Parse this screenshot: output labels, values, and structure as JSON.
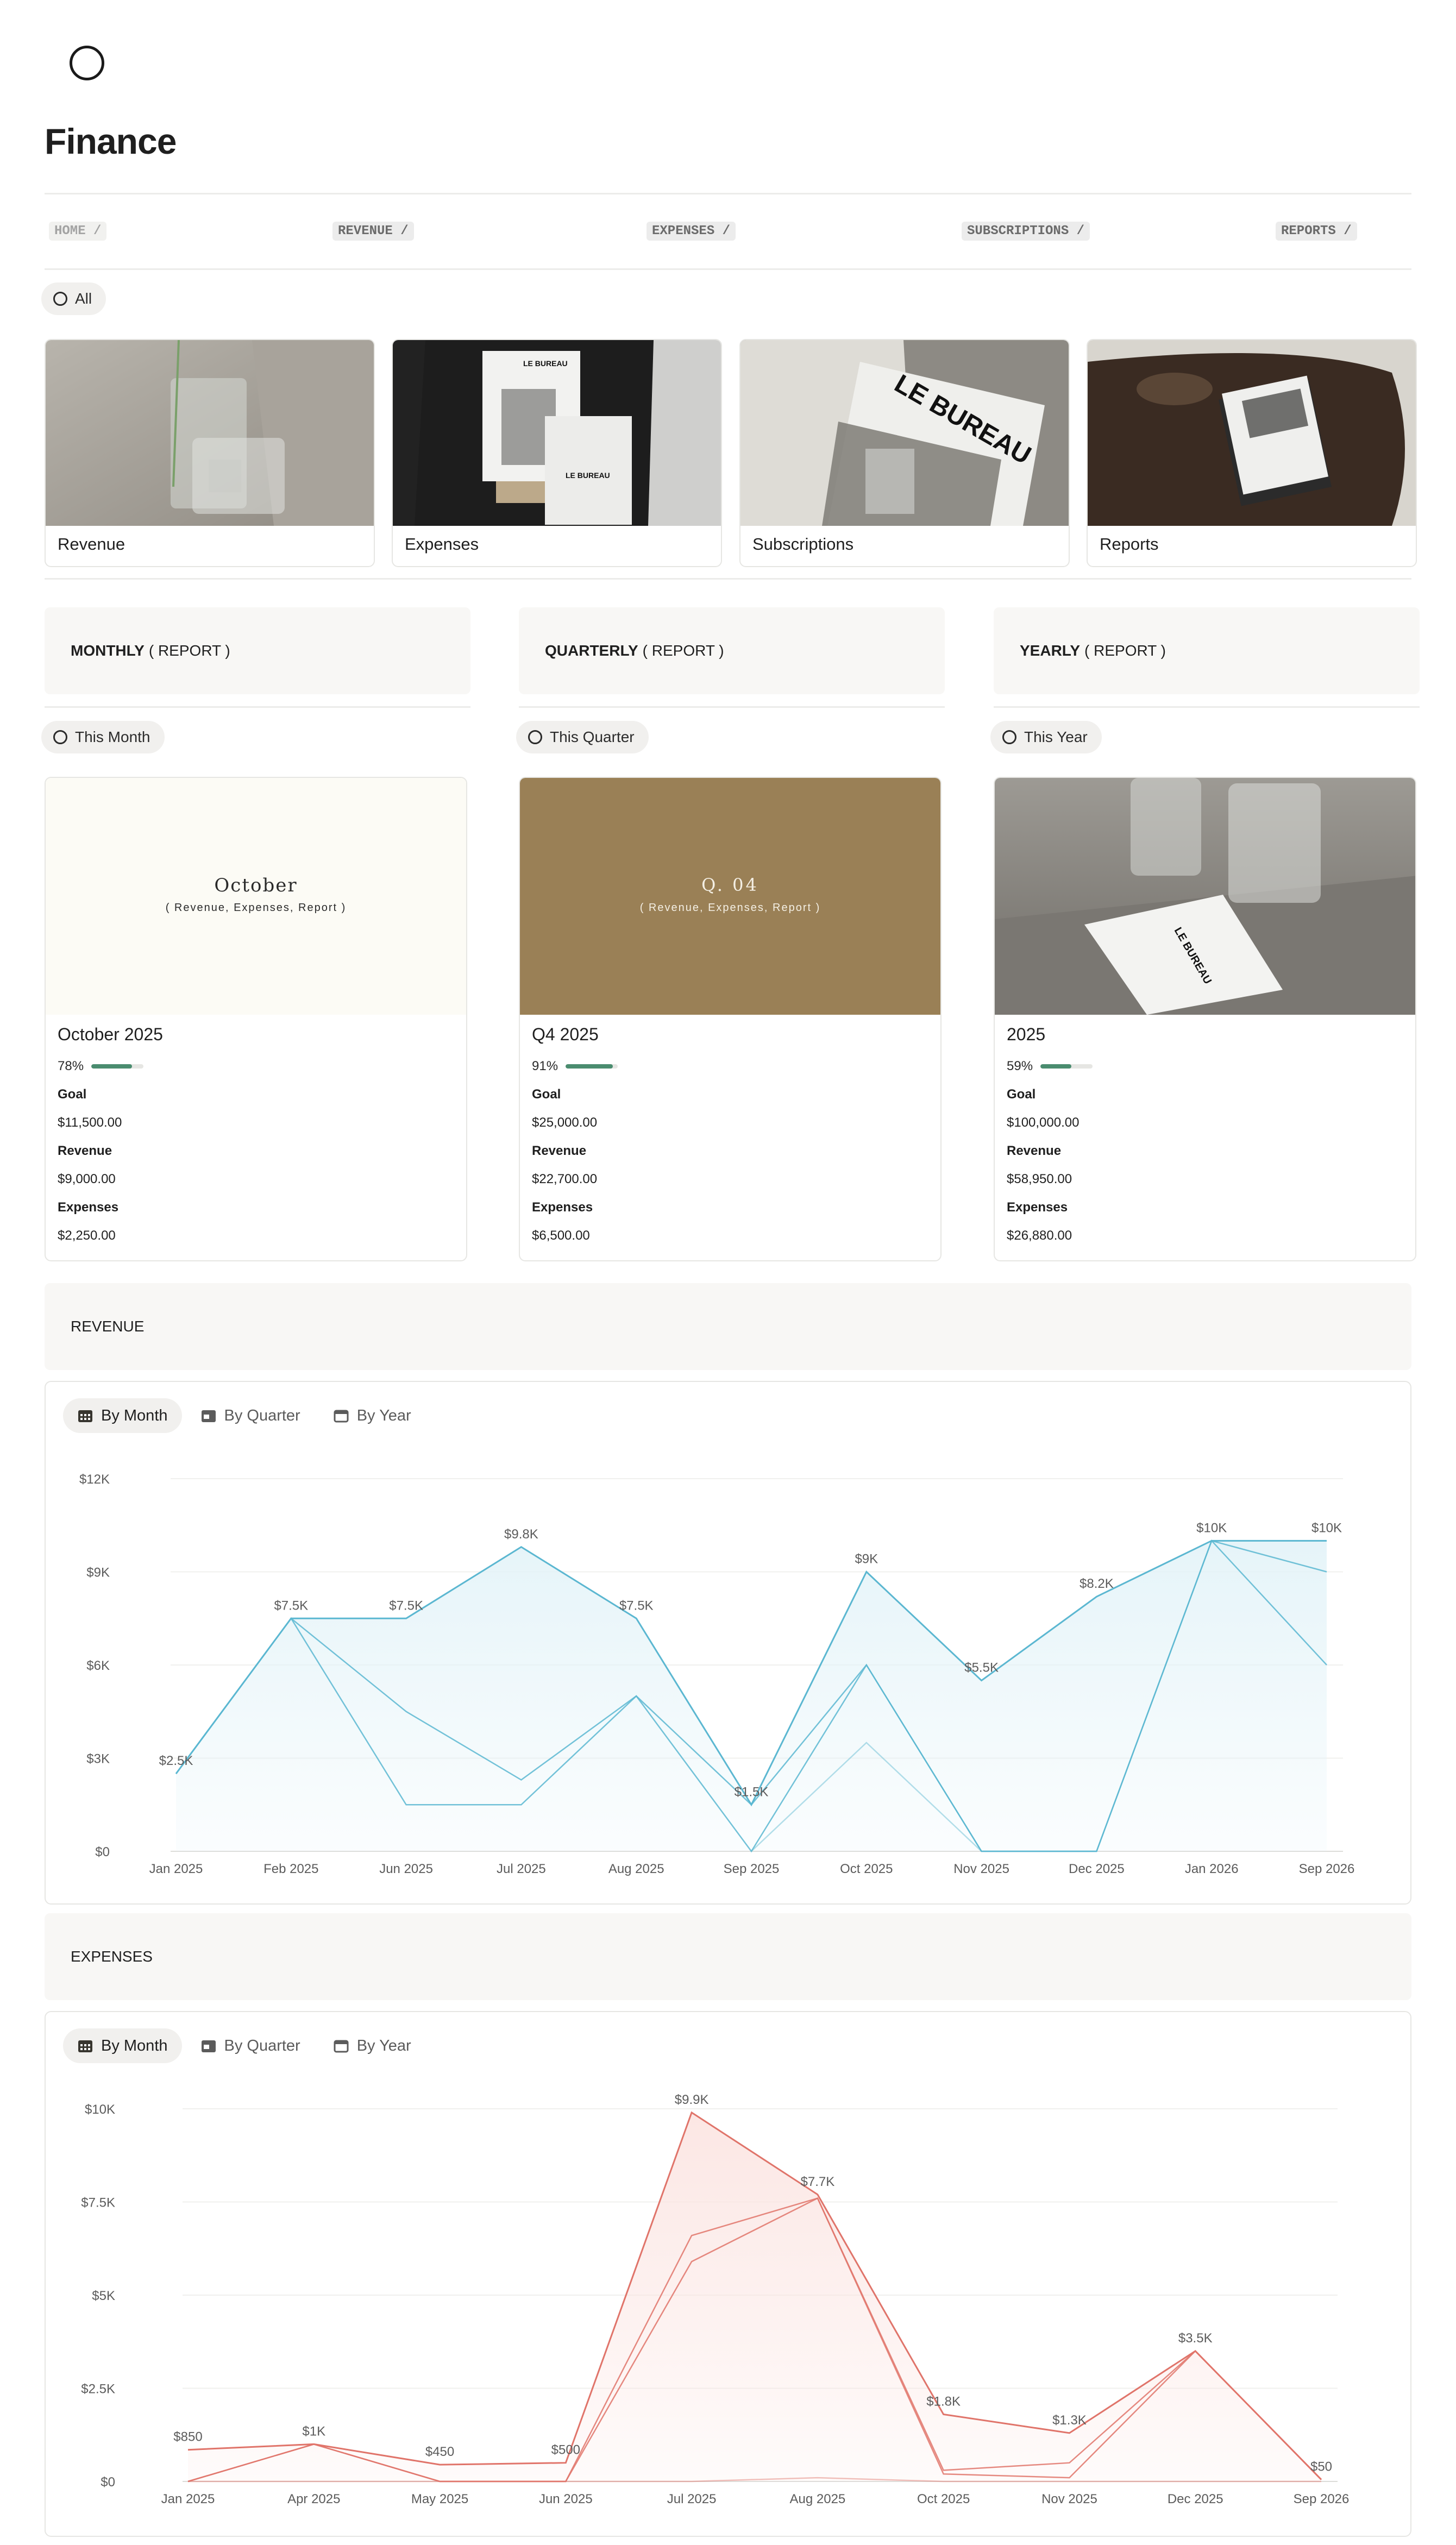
{
  "page": {
    "title": "Finance"
  },
  "nav": [
    {
      "label": "HOME /"
    },
    {
      "label": "REVENUE /"
    },
    {
      "label": "EXPENSES /"
    },
    {
      "label": "SUBSCRIPTIONS /"
    },
    {
      "label": "REPORTS /"
    }
  ],
  "gallery": {
    "filter_label": "All",
    "cards": [
      {
        "label": "Revenue"
      },
      {
        "label": "Expenses"
      },
      {
        "label": "Subscriptions"
      },
      {
        "label": "Reports"
      }
    ],
    "photo_text": {
      "brand": "LE BUREAU"
    }
  },
  "reports": [
    {
      "header_strong": "MONTHLY",
      "header_rest": "( REPORT )",
      "filter_label": "This Month",
      "cover_title": "October",
      "cover_subtitle": "( Revenue, Expenses, Report )",
      "title": "October 2025",
      "progress_label": "78%",
      "progress": 0.78,
      "goal_label": "Goal",
      "goal_value": "$11,500.00",
      "revenue_label": "Revenue",
      "revenue_value": "$9,000.00",
      "expenses_label": "Expenses",
      "expenses_value": "$2,250.00"
    },
    {
      "header_strong": "QUARTERLY",
      "header_rest": "( REPORT )",
      "filter_label": "This Quarter",
      "cover_title": "Q. 04",
      "cover_subtitle": "( Revenue, Expenses, Report )",
      "title": "Q4 2025",
      "progress_label": "91%",
      "progress": 0.91,
      "goal_label": "Goal",
      "goal_value": "$25,000.00",
      "revenue_label": "Revenue",
      "revenue_value": "$22,700.00",
      "expenses_label": "Expenses",
      "expenses_value": "$6,500.00"
    },
    {
      "header_strong": "YEARLY",
      "header_rest": "( REPORT )",
      "filter_label": "This Year",
      "cover_title": "",
      "cover_subtitle": "",
      "title": "2025",
      "progress_label": "59%",
      "progress": 0.59,
      "goal_label": "Goal",
      "goal_value": "$100,000.00",
      "revenue_label": "Revenue",
      "revenue_value": "$58,950.00",
      "expenses_label": "Expenses",
      "expenses_value": "$26,880.00"
    }
  ],
  "revenue_section": {
    "header": "REVENUE",
    "tabs": [
      "By Month",
      "By Quarter",
      "By Year"
    ]
  },
  "expenses_section": {
    "header": "EXPENSES",
    "tabs": [
      "By Month",
      "By Quarter",
      "By Year"
    ]
  },
  "colors": {
    "revenue_line": "#5bb7d1",
    "revenue_fill": "#e3f3f8",
    "expenses_line": "#e0746a",
    "expenses_fill": "#fbe4e1",
    "progress": "#4a8c6f",
    "quarter_cover": "#9a8056"
  },
  "chart_data": [
    {
      "type": "area",
      "title": "",
      "categories": [
        "Jan 2025",
        "Feb 2025",
        "Jun 2025",
        "Jul 2025",
        "Aug 2025",
        "Sep 2025",
        "Oct 2025",
        "Nov 2025",
        "Dec 2025",
        "Jan 2026",
        "Sep 2026"
      ],
      "yticks": [
        "$0",
        "$3K",
        "$6K",
        "$9K",
        "$12K"
      ],
      "ylim": [
        0,
        12000
      ],
      "series": [
        {
          "values": [
            2500,
            7500,
            7500,
            9800,
            7500,
            1500,
            9000,
            5500,
            8200,
            10000,
            10000
          ],
          "data_labels": [
            "$2.5K",
            "$7.5K",
            "$7.5K",
            "$9.8K",
            "$7.5K",
            "$1.5K",
            "$9K",
            "$5.5K",
            "$8.2K",
            "$10K",
            "$10K"
          ]
        },
        {
          "values": [
            2500,
            7500,
            4500,
            2300,
            5000,
            1500,
            6000,
            0,
            0,
            10000,
            9000
          ]
        },
        {
          "values": [
            2500,
            7500,
            1500,
            1500,
            5000,
            0,
            6000,
            0,
            0,
            10000,
            6000
          ]
        },
        {
          "values": [
            null,
            null,
            null,
            null,
            null,
            0,
            3500,
            0,
            null,
            null,
            null
          ]
        }
      ],
      "grid": true
    },
    {
      "type": "area",
      "title": "",
      "categories": [
        "Jan 2025",
        "Apr 2025",
        "May 2025",
        "Jun 2025",
        "Jul 2025",
        "Aug 2025",
        "Oct 2025",
        "Nov 2025",
        "Dec 2025",
        "Sep 2026"
      ],
      "yticks": [
        "$0",
        "$2.5K",
        "$5K",
        "$7.5K",
        "$10K"
      ],
      "ylim": [
        0,
        10000
      ],
      "series": [
        {
          "values": [
            850,
            1000,
            450,
            500,
            9900,
            7700,
            1800,
            1300,
            3500,
            50
          ],
          "data_labels": [
            "$850",
            "$1K",
            "$450",
            "$500",
            "$9.9K",
            "$7.7K",
            "$1.8K",
            "$1.3K",
            "$3.5K",
            "$50"
          ]
        },
        {
          "values": [
            0,
            1000,
            0,
            0,
            6600,
            7600,
            300,
            500,
            3500,
            50
          ]
        },
        {
          "values": [
            0,
            1000,
            0,
            0,
            5900,
            7600,
            200,
            100,
            3500,
            50
          ]
        },
        {
          "values": [
            0,
            0,
            0,
            0,
            0,
            100,
            0,
            0,
            0,
            0
          ]
        }
      ],
      "grid": true
    }
  ]
}
